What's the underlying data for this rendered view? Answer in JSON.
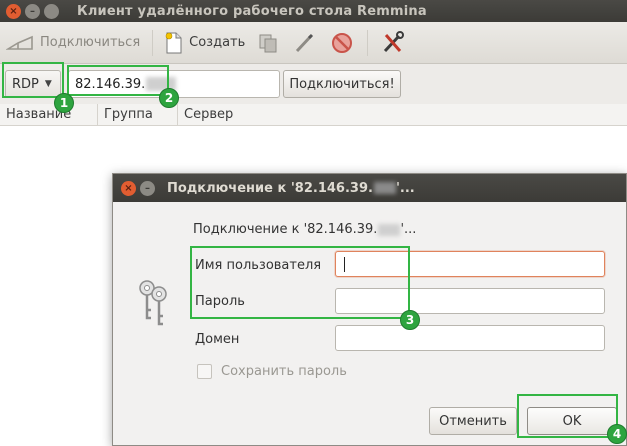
{
  "window": {
    "title": "Клиент удалённого рабочего стола Remmina"
  },
  "toolbar": {
    "connect_label": "Подключиться",
    "create_label": "Создать"
  },
  "quickbar": {
    "protocol": "RDP",
    "server_value": "82.146.39.",
    "connect_button": "Подключиться!"
  },
  "list": {
    "columns": [
      "Название",
      "Группа",
      "Сервер"
    ]
  },
  "dialog": {
    "title": "Подключение к '82.146.39.",
    "title_suffix": "'...",
    "header": "Подключение к '82.146.39.",
    "header_suffix": "'...",
    "fields": [
      {
        "label": "Имя пользователя",
        "value": ""
      },
      {
        "label": "Пароль",
        "value": ""
      },
      {
        "label": "Домен",
        "value": ""
      }
    ],
    "save_password": "Сохранить пароль",
    "cancel": "Отменить",
    "ok": "OK"
  },
  "annotations": [
    "1",
    "2",
    "3",
    "4"
  ],
  "colors": {
    "highlight": "#33b544",
    "badge": "#2ea43f",
    "close_button": "#e25d31",
    "focus_border": "#e0835c"
  }
}
